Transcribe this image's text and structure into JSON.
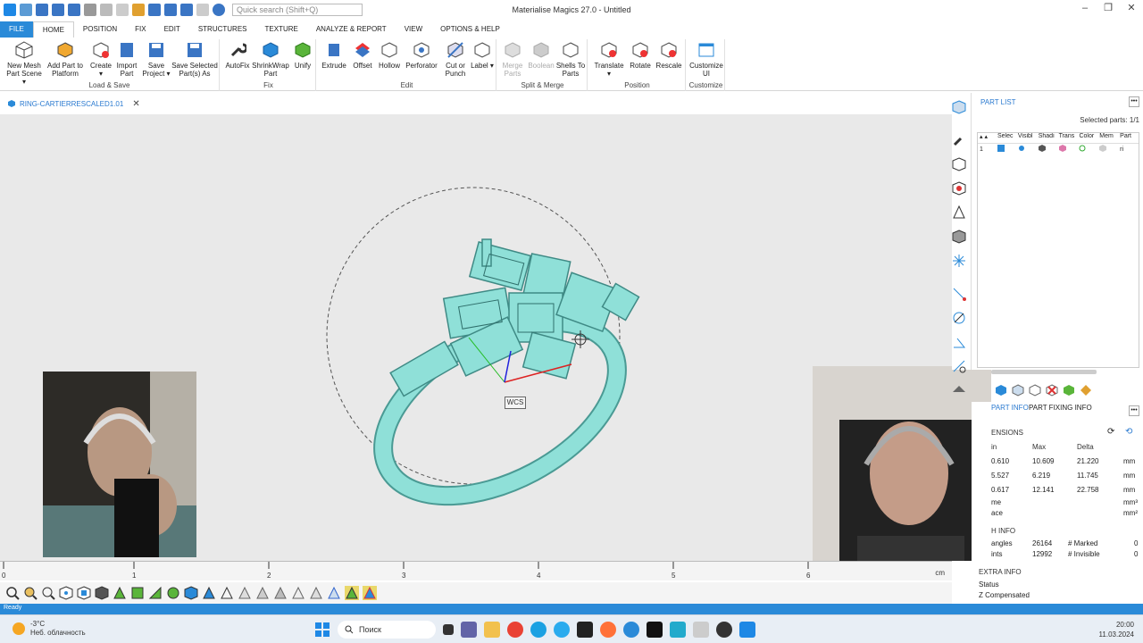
{
  "titlebar": {
    "search_placeholder": "Quick search (Shift+Q)",
    "title": "Materialise Magics 27.0 - Untitled",
    "controls": [
      "–",
      "❐",
      "✕"
    ]
  },
  "menu": {
    "tabs": [
      "FILE",
      "HOME",
      "POSITION",
      "FIX",
      "EDIT",
      "STRUCTURES",
      "TEXTURE",
      "ANALYZE & REPORT",
      "VIEW",
      "OPTIONS & HELP"
    ]
  },
  "ribbon": {
    "groups": [
      {
        "label": "Load & Save",
        "buttons": [
          "New Mesh Part Scene ▾",
          "Add Part to Platform",
          "Create ▾",
          "Import Part",
          "Save Project ▾",
          "Save Selected Part(s) As"
        ]
      },
      {
        "label": "Fix",
        "buttons": [
          "AutoFix",
          "ShrinkWrap Part",
          "Unify"
        ]
      },
      {
        "label": "Edit",
        "buttons": [
          "Extrude",
          "Offset",
          "Hollow",
          "Perforator",
          "Cut or Punch",
          "Label ▾"
        ]
      },
      {
        "label": "Split & Merge",
        "buttons": [
          "Merge Parts",
          "Boolean",
          "Shells To Parts"
        ]
      },
      {
        "label": "Position",
        "buttons": [
          "Translate ▾",
          "Rotate",
          "Rescale"
        ]
      },
      {
        "label": "Customize",
        "buttons": [
          "Customize UI"
        ]
      }
    ]
  },
  "document_tab": {
    "label": "RING-CARTIERRESCALED1.01",
    "close": "✕"
  },
  "viewport": {
    "wcs_label": "WCS"
  },
  "ruler": {
    "ticks": [
      "0",
      "1",
      "2",
      "3",
      "4",
      "5",
      "6"
    ],
    "unit": "cm"
  },
  "part_list": {
    "title": "PART LIST",
    "selected": "Selected parts: 1/1",
    "columns": [
      "Selec",
      "Visibl",
      "Shadi",
      "Trans",
      "Color",
      "Mem",
      "Part"
    ],
    "row_number": "1"
  },
  "info": {
    "tabs": [
      "PART INFO",
      "PART FIXING INFO"
    ],
    "dimensions_title": "ENSIONS",
    "col_labels": [
      "in",
      "Max",
      "Delta"
    ],
    "rows": [
      {
        "min": "0.610",
        "max": "10.609",
        "delta": "21.220",
        "unit": "mm"
      },
      {
        "min": "5.527",
        "max": "6.219",
        "delta": "11.745",
        "unit": "mm"
      },
      {
        "min": "0.617",
        "max": "12.141",
        "delta": "22.758",
        "unit": "mm"
      }
    ],
    "volume_label": "me",
    "volume_unit": "mm³",
    "surface_label": "ace",
    "surface_unit": "mm²",
    "mesh_title": "H INFO",
    "triangles_label": "angles",
    "triangles": "26164",
    "points_label": "ints",
    "points": "12992",
    "marked_label": "# Marked",
    "marked": "0",
    "invisible_label": "# Invisible",
    "invisible": "0",
    "extra_title": "EXTRA INFO",
    "status_label": "Status",
    "z_label": "Z Compensated"
  },
  "status": {
    "text": "Ready"
  },
  "taskbar": {
    "weather_temp": "-3°C",
    "weather_desc": "Неб. облачность",
    "search_label": "Поиск",
    "time": "20:00",
    "date": "11.03.2024"
  },
  "colors": {
    "accent": "#2a8ad8",
    "viewport_bg": "#e9e9e9",
    "model": "#8fe0d8"
  }
}
